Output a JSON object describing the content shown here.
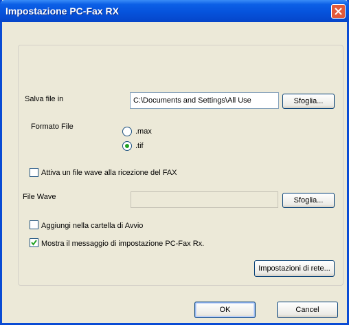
{
  "window": {
    "title": "Impostazione PC-Fax RX"
  },
  "save": {
    "label": "Salva file in",
    "path": "C:\\Documents and Settings\\All Use",
    "browse_label": "Sfoglia..."
  },
  "format": {
    "label": "Formato File",
    "options": [
      {
        "label": ".max",
        "selected": false
      },
      {
        "label": ".tif",
        "selected": true
      }
    ]
  },
  "wave_toggle": {
    "label": "Attiva un file wave alla ricezione del FAX",
    "checked": false
  },
  "wave": {
    "label": "File Wave",
    "value": "",
    "browse_label": "Sfoglia..."
  },
  "startup": {
    "label": "Aggiungi nella cartella di Avvio",
    "checked": false
  },
  "show_message": {
    "label": "Mostra il messaggio di impostazione PC-Fax Rx.",
    "checked": true
  },
  "network_button": "Impostazioni di rete...",
  "footer": {
    "ok": "OK",
    "cancel": "Cancel"
  },
  "colors": {
    "title_bar": "#0653dc",
    "dialog_bg": "#ece9d8",
    "radio_dot": "#21a121",
    "check_mark": "#21a121"
  }
}
